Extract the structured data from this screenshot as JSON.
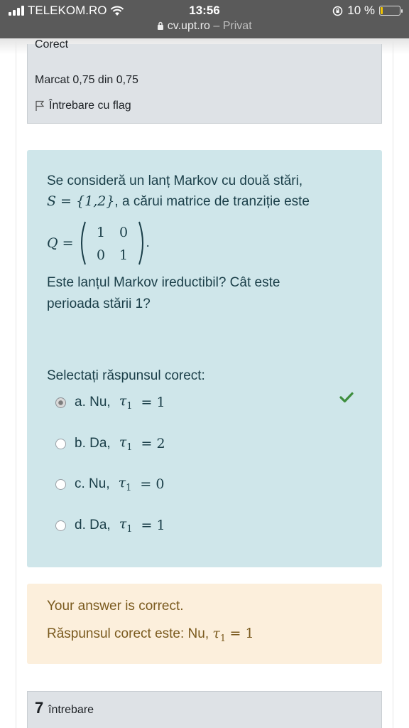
{
  "status_bar": {
    "carrier": "TELEKOM.RO",
    "time": "13:56",
    "url": "cv.upt.ro",
    "privacy": "– Privat",
    "battery_text": "10 %",
    "battery_level": 0.1,
    "battery_color": "#f2c500"
  },
  "info": {
    "state": "Corect",
    "marks": "Marcat 0,75 din 0,75",
    "flag_label": "Întrebare cu flag"
  },
  "question": {
    "line1": "Se consideră un lanț Markov cu două stări,",
    "set_math": "S = {1,2}",
    "line2_rest": ", a cărui matrice de tranziție este",
    "matrix_lhs": "Q =",
    "matrix": [
      [
        "1",
        "0"
      ],
      [
        "0",
        "1"
      ]
    ],
    "matrix_tail": ".",
    "line3": "Este lanțul Markov ireductibil?  Cât este",
    "line4": "perioada stării 1?"
  },
  "answer": {
    "prompt": "Selectați răspunsul corect:",
    "options": [
      {
        "prefix": "a. Nu,",
        "math": "τ",
        "sub": "1",
        "eq": "= 1",
        "selected": true,
        "correct": true
      },
      {
        "prefix": "b. Da,",
        "math": "τ",
        "sub": "1",
        "eq": "= 2",
        "selected": false,
        "correct": false
      },
      {
        "prefix": "c. Nu,",
        "math": "τ",
        "sub": "1",
        "eq": "= 0",
        "selected": false,
        "correct": false
      },
      {
        "prefix": "d. Da,",
        "math": "τ",
        "sub": "1",
        "eq": "= 1",
        "selected": false,
        "correct": false
      }
    ],
    "check_color": "#3e8e3e"
  },
  "feedback": {
    "result": "Your answer is correct.",
    "correct_prefix": "Răspunsul corect este: Nu,",
    "correct_math": "τ",
    "correct_sub": "1",
    "correct_eq": "= 1"
  },
  "next_question": {
    "number": "7",
    "label": "întrebare"
  },
  "colors": {
    "content_bg": "#cfe6ea",
    "feedback_bg": "#fcefdc",
    "info_bg": "#dee2e6"
  }
}
